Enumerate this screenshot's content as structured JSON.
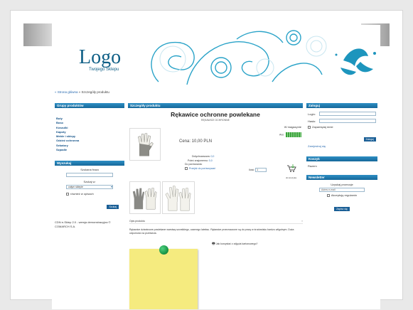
{
  "header": {
    "logo": "Logo",
    "logo_sub": "Twojego Sklepu"
  },
  "breadcrumb": {
    "home": "« Strona główna",
    "sep": " » ",
    "current": "Szczegóły produktu"
  },
  "left": {
    "groups_title": "Grupy produktów",
    "groups": [
      "Buty",
      "Boso",
      "Koszulki",
      "Kapoty",
      "Meble i sklepy",
      "Odzież ochronna",
      "Sekatory",
      "Szpadle"
    ],
    "search_title": "Wyszukaj",
    "search_label": "Szukana fraza",
    "search_in_label": "Szukaj w:",
    "search_in_value": "całym sklepie",
    "search_desc_label": "również w opisach",
    "search_button": "Szukaj",
    "footer": "CDN e-Sklep 2.0 - wersja demonstracyjna © COMARCH S.A."
  },
  "center": {
    "title": "Szczegóły produktu",
    "product_name": "Rękawice ochronne powlekane",
    "product_code": "RĘKAWICE OCHRONNE",
    "availability_label": "W magazynie",
    "price": "Cena: 10,00 PLN",
    "avail_short": "Avo",
    "attr1_label": "Dotychczasowa:",
    "attr1_value": "0,0",
    "attr2_label": "Poleć znajomemu:",
    "attr2_value": "0,0",
    "compare_label": "Do porównania:",
    "compare_link": "Przejdź do porównywań",
    "qty_label": "Ilość:",
    "qty_value": "1",
    "cart_label": "do koszyka",
    "desc_header": "Opis produktu",
    "desc_text": "Rękawice dzianinowe powlekane warstwą szorstkiego, czarnego lateksu. Rękawice przeznaczone są do pracy w środowisku bardzo wilgotnym. Duża odporność na przetarcia.",
    "ask_link": "Jak korzystać z zdjęcia kartonowego?"
  },
  "right": {
    "login_title": "Zaloguj",
    "login_label": "Login:",
    "password_label": "Hasło:",
    "remember_label": "Zapamiętaj mnie",
    "login_button": "Zaloguj",
    "register_link": "Zarejestruj się",
    "cart_title": "Koszyk",
    "cart_text": "Razem",
    "newsletter_title": "Newsletter",
    "newsletter_text": "Uzyskaj promocje",
    "email_placeholder": "Adres e-mail",
    "accept_label": "Akceptuję regulamin",
    "newsletter_button": "Zapisz się"
  },
  "colors": {
    "accent": "#1a6fa5",
    "swirl": "#2aa3c8",
    "note": "#f5eb7f",
    "pin": "#1b9a4a"
  }
}
